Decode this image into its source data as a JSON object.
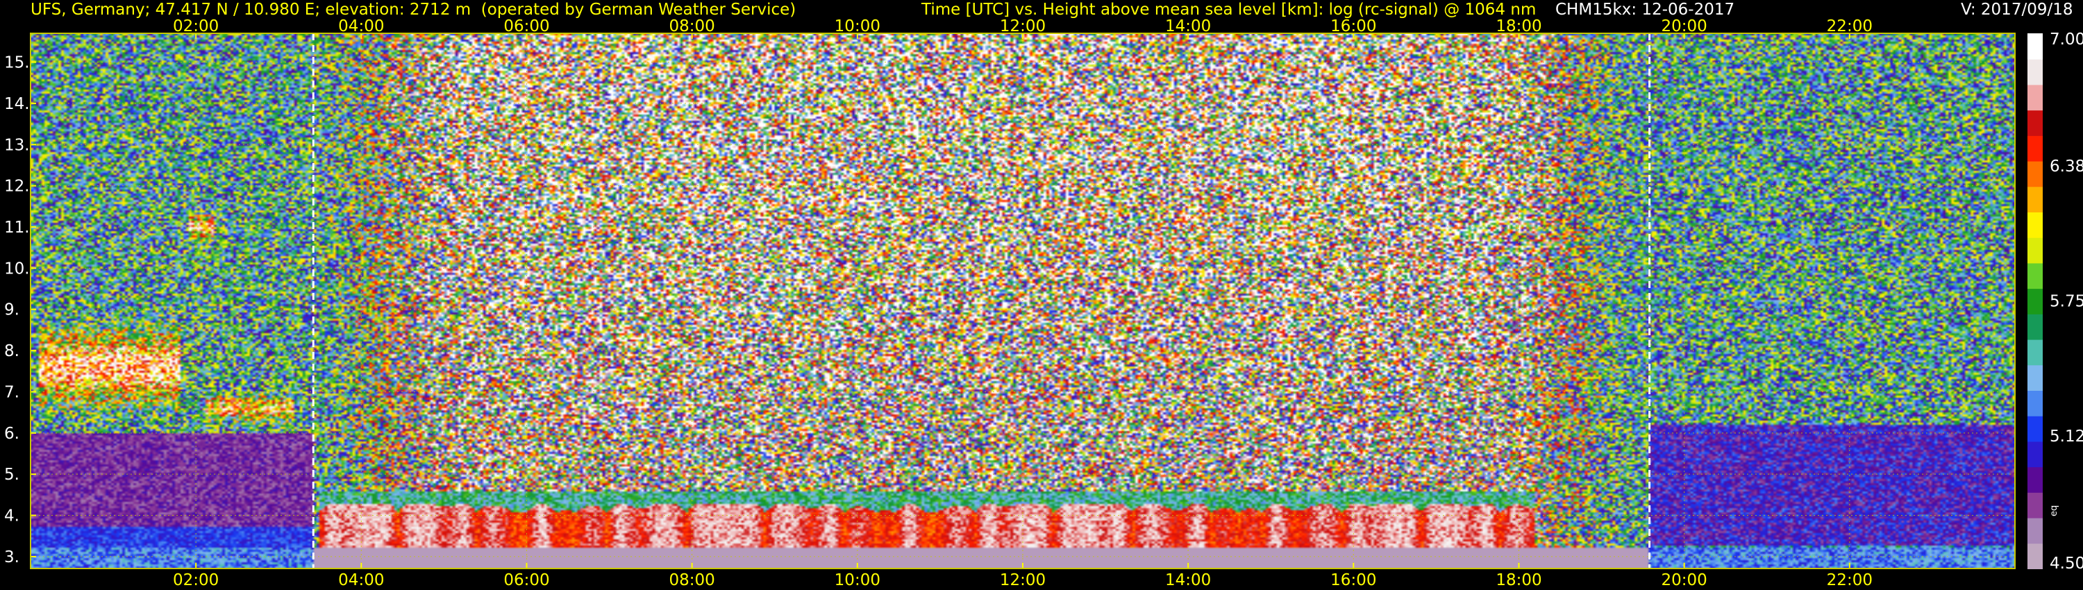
{
  "header": {
    "station": "UFS, Germany; 47.417 N / 10.980 E; elevation: 2712 m  (operated by German Weather Service)",
    "description": "Time [UTC] vs. Height above mean sea level [km]: log (rc-signal) @ 1064 nm",
    "instrument_date": "CHM15kx: 12-06-2017",
    "version": "V: 2017/09/18"
  },
  "colors": {
    "background": "#000000",
    "text": "#ffff00",
    "text_white": "#ffffff",
    "grid": "#c8c800",
    "marker": "#ffffff"
  },
  "chart_data": {
    "type": "heatmap",
    "x": {
      "unit": "hours UTC",
      "range": [
        0,
        24
      ],
      "ticks": [
        2,
        4,
        6,
        8,
        10,
        12,
        14,
        16,
        18,
        20,
        22
      ],
      "tick_labels": [
        "02:00",
        "04:00",
        "06:00",
        "08:00",
        "10:00",
        "12:00",
        "14:00",
        "16:00",
        "18:00",
        "20:00",
        "22:00"
      ]
    },
    "y": {
      "unit": "km",
      "range": [
        2.712,
        15.7
      ],
      "ticks": [
        3,
        4,
        5,
        6,
        7,
        8,
        9,
        10,
        11,
        12,
        13,
        14,
        15
      ],
      "tick_labels": [
        "3.",
        "4.",
        "5.",
        "6.",
        "7.",
        "8.",
        "9.",
        "10.",
        "11.",
        "12.",
        "13.",
        "14.",
        "15."
      ]
    },
    "grid": true,
    "markers": [
      3.42,
      19.58
    ],
    "colorbar": {
      "range": [
        4.5,
        7.0
      ],
      "tick_values": [
        4.5,
        5.12,
        5.75,
        6.38,
        7.0
      ],
      "tick_labels": [
        "4.50",
        "5.12",
        "5.75",
        "6.38",
        "7.00"
      ],
      "annotation": "eq",
      "colors": [
        "#c0a8c0",
        "#a888b8",
        "#8c3c98",
        "#5a0a96",
        "#2c1cd0",
        "#1a3cf2",
        "#4c88f0",
        "#80b8ee",
        "#50c0b0",
        "#169a58",
        "#1a9a1a",
        "#66d02c",
        "#dcec0a",
        "#fff200",
        "#ffb000",
        "#ff7000",
        "#ff2000",
        "#cc1010",
        "#f0a8a8",
        "#f0e8e8",
        "#ffffff"
      ]
    }
  }
}
